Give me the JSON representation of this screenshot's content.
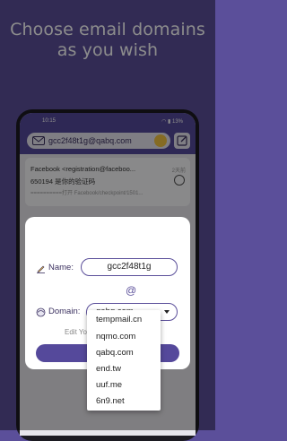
{
  "headline": {
    "line1": "Choose email domains",
    "line2": "as you wish"
  },
  "status_bar": {
    "time": "10:15",
    "battery": "13%"
  },
  "top_bar": {
    "address": "gcc2f48t1g@qabq.com"
  },
  "email_card": {
    "from": "Facebook <registration@faceboo...",
    "time": "2天前",
    "subject": "650194 是你的验证码",
    "body": "==========打开 Facebook/checkpoint/1501..."
  },
  "dialog": {
    "name_label": "Name:",
    "name_value": "gcc2f48t1g",
    "at_symbol": "@",
    "domain_label": "Domain:",
    "domain_value": "qabq.com",
    "edit_hint": "Edit Yo"
  },
  "dropdown": {
    "options": [
      "tempmail.cn",
      "nqmo.com",
      "qabq.com",
      "end.tw",
      "uuf.me",
      "6n9.net"
    ]
  },
  "colors": {
    "background": "#5b4f9a",
    "accent": "#55499b",
    "copy_badge": "#f3c443"
  }
}
